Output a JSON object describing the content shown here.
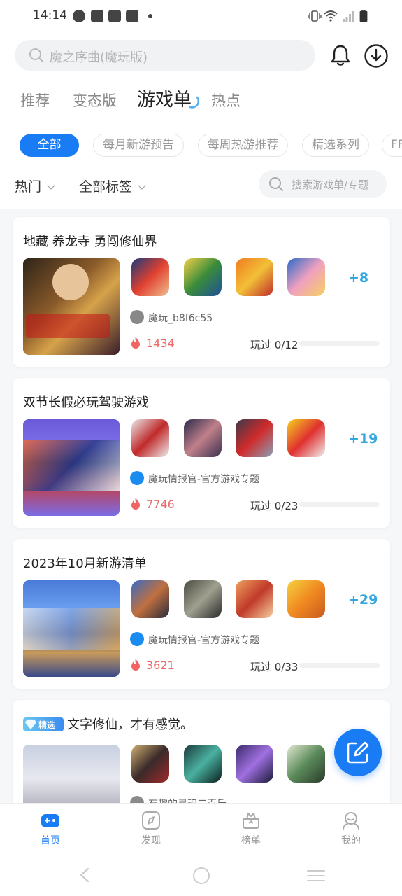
{
  "status_bar": {
    "time": "14:14"
  },
  "search": {
    "placeholder": "魔之序曲(魔玩版)"
  },
  "tabs": [
    {
      "label": "推荐"
    },
    {
      "label": "变态版"
    },
    {
      "label": "游戏单"
    },
    {
      "label": "热点"
    }
  ],
  "chips": [
    {
      "label": "全部"
    },
    {
      "label": "每月新游预告"
    },
    {
      "label": "每周热游推荐"
    },
    {
      "label": "精选系列"
    },
    {
      "label": "FF"
    }
  ],
  "filters": {
    "sort": "热门",
    "tags": "全部标签",
    "search_placeholder": "搜索游戏单/专题"
  },
  "lists": [
    {
      "title": "地藏 养龙寺 勇闯修仙界",
      "more": "+8",
      "author": "魔玩_b8f6c55",
      "heat": "1434",
      "played": "玩过 0/12",
      "played_fraction": 0
    },
    {
      "title": "双节长假必玩驾驶游戏",
      "more": "+19",
      "author": "魔玩情报官-官方游戏专题",
      "heat": "7746",
      "played": "玩过 0/23",
      "played_fraction": 0
    },
    {
      "title": "2023年10月新游清单",
      "more": "+29",
      "author": "魔玩情报官-官方游戏专题",
      "heat": "3621",
      "played": "玩过 0/33",
      "played_fraction": 0
    },
    {
      "badge": "精选",
      "title": "文字修仙，才有感觉。",
      "author": "有趣的灵魂二百斤"
    }
  ],
  "bottom_nav": [
    {
      "label": "首页",
      "icon": "home-gamepad-icon"
    },
    {
      "label": "发现",
      "icon": "compass-icon"
    },
    {
      "label": "榜单",
      "icon": "ranking-icon"
    },
    {
      "label": "我的",
      "icon": "profile-icon"
    }
  ],
  "colors": {
    "accent": "#1a7cf5",
    "heat": "#e96a6a",
    "more": "#33a8e0"
  }
}
